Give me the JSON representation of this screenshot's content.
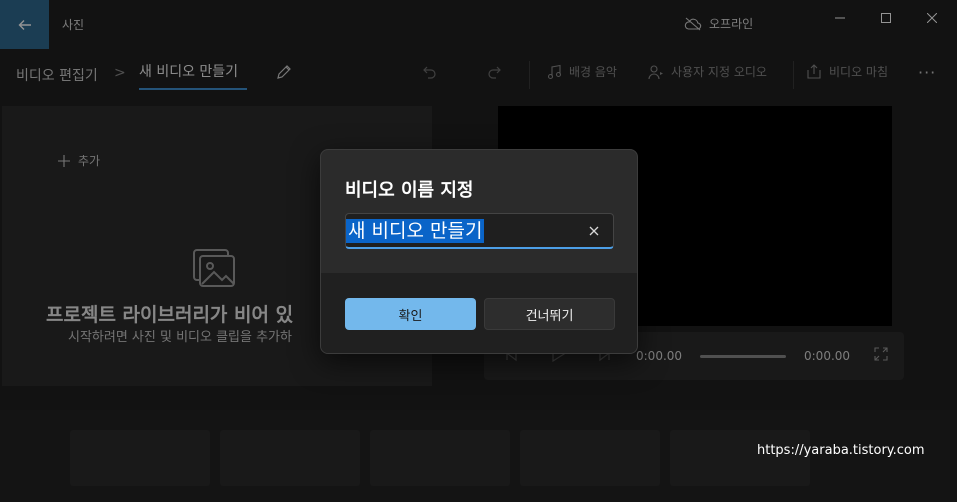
{
  "titlebar": {
    "app_title": "사진",
    "offline_label": "오프라인",
    "icons": {
      "back": "back-arrow-icon",
      "offline": "cloud-offline-icon",
      "minimize": "minimize-icon",
      "maximize": "maximize-icon",
      "close": "close-icon"
    }
  },
  "toolbar": {
    "breadcrumb_root": "비디오 편집기",
    "breadcrumb_separator": ">",
    "breadcrumb_current": "새 비디오 만들기",
    "background_music": "배경 음악",
    "custom_audio": "사용자 지정 오디오",
    "finish_video": "비디오 마침",
    "more": "···",
    "icons": [
      "pencil-icon",
      "undo-icon",
      "redo-icon",
      "music-note-icon",
      "custom-audio-icon",
      "export-icon",
      "more-icon"
    ]
  },
  "library": {
    "add_label": "추가",
    "empty_title": "프로젝트 라이브러리가 비어 있",
    "empty_subtitle": "시작하려면 사진 및 비디오 클립을 추가하"
  },
  "player": {
    "current_time": "0:00.00",
    "total_time": "0:00.00"
  },
  "dialog": {
    "title": "비디오 이름 지정",
    "input_value": "새 비디오 만들기",
    "ok_label": "확인",
    "skip_label": "건너뛰기"
  },
  "watermark": "https://yaraba.tistory.com",
  "colors": {
    "accent": "#73b8ec",
    "selection": "#0a64c8",
    "back_button": "#2f6a8f",
    "underline": "#3f8fd1"
  }
}
